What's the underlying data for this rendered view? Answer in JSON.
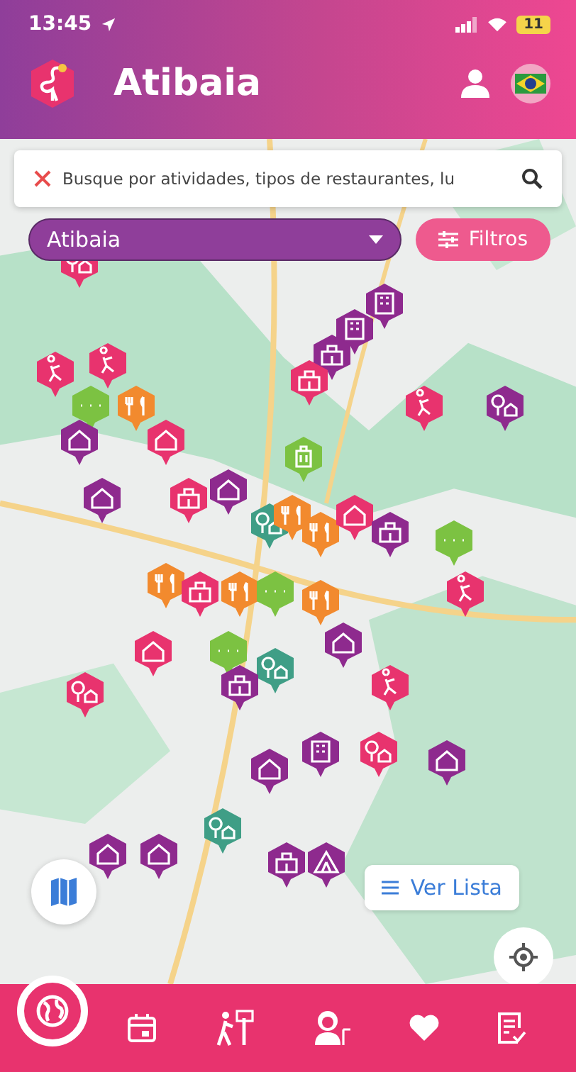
{
  "status_bar": {
    "time": "13:45",
    "battery": "11"
  },
  "header": {
    "title": "Atibaia"
  },
  "search": {
    "placeholder": "Busque por atividades, tipos de restaurantes, lu"
  },
  "city_select": {
    "value": "Atibaia"
  },
  "filter_button": {
    "label": "Filtros"
  },
  "map": {
    "pins": [
      {
        "color": "#e8336e",
        "kind": "nature"
      },
      {
        "color": "#8e2a8e",
        "kind": "hotel"
      },
      {
        "color": "#8e2a8e",
        "kind": "hotel"
      },
      {
        "color": "#8e2a8e",
        "kind": "building"
      },
      {
        "color": "#e8336e",
        "kind": "building"
      },
      {
        "color": "#e8336e",
        "kind": "activity"
      },
      {
        "color": "#e8336e",
        "kind": "activity"
      },
      {
        "color": "#7cc242",
        "kind": "more"
      },
      {
        "color": "#f28a2e",
        "kind": "food"
      },
      {
        "color": "#8e2a8e",
        "kind": "home"
      },
      {
        "color": "#e8336e",
        "kind": "home"
      },
      {
        "color": "#7cc242",
        "kind": "luggage"
      },
      {
        "color": "#8e2a8e",
        "kind": "nature"
      },
      {
        "color": "#e8336e",
        "kind": "activity"
      },
      {
        "color": "#8e2a8e",
        "kind": "home"
      },
      {
        "color": "#e8336e",
        "kind": "building"
      },
      {
        "color": "#8e2a8e",
        "kind": "home"
      },
      {
        "color": "#3f9e86",
        "kind": "nature"
      },
      {
        "color": "#f28a2e",
        "kind": "food"
      },
      {
        "color": "#f28a2e",
        "kind": "food"
      },
      {
        "color": "#e8336e",
        "kind": "home"
      },
      {
        "color": "#8e2a8e",
        "kind": "building"
      },
      {
        "color": "#7cc242",
        "kind": "more"
      },
      {
        "color": "#e8336e",
        "kind": "activity"
      },
      {
        "color": "#f28a2e",
        "kind": "food"
      },
      {
        "color": "#e8336e",
        "kind": "building"
      },
      {
        "color": "#f28a2e",
        "kind": "food"
      },
      {
        "color": "#7cc242",
        "kind": "more"
      },
      {
        "color": "#f28a2e",
        "kind": "food"
      },
      {
        "color": "#8e2a8e",
        "kind": "home"
      },
      {
        "color": "#7cc242",
        "kind": "more"
      },
      {
        "color": "#3f9e86",
        "kind": "nature"
      },
      {
        "color": "#8e2a8e",
        "kind": "building"
      },
      {
        "color": "#e8336e",
        "kind": "home"
      },
      {
        "color": "#e8336e",
        "kind": "nature"
      },
      {
        "color": "#e8336e",
        "kind": "activity"
      },
      {
        "color": "#8e2a8e",
        "kind": "hotel"
      },
      {
        "color": "#8e2a8e",
        "kind": "home"
      },
      {
        "color": "#e8336e",
        "kind": "nature"
      },
      {
        "color": "#3f9e86",
        "kind": "nature"
      },
      {
        "color": "#8e2a8e",
        "kind": "home"
      },
      {
        "color": "#8e2a8e",
        "kind": "home"
      },
      {
        "color": "#8e2a8e",
        "kind": "building"
      },
      {
        "color": "#8e2a8e",
        "kind": "tent"
      },
      {
        "color": "#8e2a8e",
        "kind": "home"
      }
    ]
  },
  "list_button": {
    "label": "Ver Lista"
  },
  "nav": {
    "items": [
      {
        "kind": "calendar"
      },
      {
        "kind": "hiker"
      },
      {
        "kind": "explorer"
      },
      {
        "kind": "heart"
      },
      {
        "kind": "checklist"
      }
    ]
  }
}
